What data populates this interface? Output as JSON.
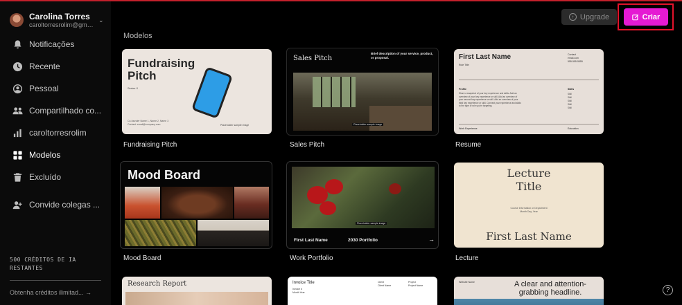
{
  "profile": {
    "name": "Carolina Torres",
    "email": "caroltorresrolim@gmail.com"
  },
  "sidebar": {
    "items": [
      {
        "label": "Notificações",
        "icon": "bell-icon"
      },
      {
        "label": "Recente",
        "icon": "clock-icon"
      },
      {
        "label": "Pessoal",
        "icon": "user-circle-icon"
      },
      {
        "label": "Compartilhado co...",
        "icon": "users-icon"
      },
      {
        "label": "caroltorresrolim",
        "icon": "bar-chart-icon"
      },
      {
        "label": "Modelos",
        "icon": "grid-icon",
        "active": true
      },
      {
        "label": "Excluído",
        "icon": "trash-icon"
      }
    ],
    "invite_label": "Convide colegas ...",
    "credits_line1": "500 CRÉDITOS DE IA",
    "credits_line2": "RESTANTES",
    "get_credits_label": "Obtenha créditos ilimitad... →"
  },
  "topbar": {
    "upgrade_label": "Upgrade",
    "create_label": "Criar",
    "accent_color": "#e51ad3"
  },
  "main": {
    "section_title": "Modelos",
    "templates": [
      {
        "label": "Fundraising Pitch",
        "title_line1": "Fundraising",
        "title_line2": "Pitch",
        "series": "Series X",
        "footer": "Co-founder Name 1, Name 2, Name 3",
        "footer2": "Contact: email@company.com",
        "image_caption": "Placeholder sample image"
      },
      {
        "label": "Sales Pitch",
        "title": "Sales Pitch",
        "description": "Brief description of your service, product, or proposal.",
        "image_caption": "Placeholder sample image"
      },
      {
        "label": "Resume",
        "name": "First Last Name",
        "subtitle": "Role Title",
        "contact_label": "Contact",
        "contact_line1": "email.com",
        "contact_line2": "555-555-5555",
        "profile_label": "Profile",
        "profile_text": "Share a snapshot of your key experience and skills. Add an overview of your key experience or skill. Add an overview of your second key experience or skill. Add an overview of your third key experience or skill. Connect your experience and skills to the type of role you're targeting.",
        "skills_label": "Skills",
        "skills": [
          "Skill",
          "Skill",
          "Skill",
          "Skill",
          "Skill"
        ],
        "work_label": "Work Experience",
        "education_label": "Education"
      },
      {
        "label": "Mood Board",
        "title": "Mood Board"
      },
      {
        "label": "Work Portfolio",
        "footer_name": "First Last Name",
        "footer_portfolio": "2030 Portfolio",
        "arrow": "→",
        "image_caption": "Placeholder sample image"
      },
      {
        "label": "Lecture",
        "title_line1": "Lecture",
        "title_line2": "Title",
        "meta_line1": "Course Information or Department",
        "meta_line2": "Month Day, Year",
        "name": "First Last Name"
      },
      {
        "title": "Research Report"
      },
      {
        "title": "Invoice Title",
        "client_label": "Client",
        "client_name": "Client Name",
        "project_label": "Project",
        "project_name": "Project Name",
        "invoice_label": "Invoice #",
        "issued_label": "Month Year"
      },
      {
        "website": "Website Name",
        "headline": "A clear and attention-grabbing headline."
      }
    ]
  },
  "help_label": "?"
}
